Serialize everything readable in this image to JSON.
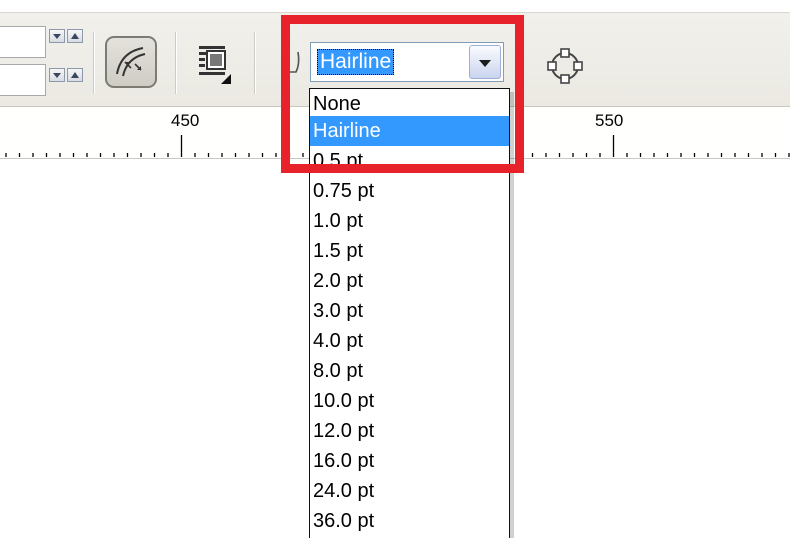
{
  "toolbar": {
    "outline_width": {
      "value": "Hairline",
      "options": [
        "None",
        "Hairline",
        "0.5 pt",
        "0.75 pt",
        "1.0 pt",
        "1.5 pt",
        "2.0 pt",
        "3.0 pt",
        "4.0 pt",
        "8.0 pt",
        "10.0 pt",
        "12.0 pt",
        "16.0 pt",
        "24.0 pt",
        "36.0 pt"
      ],
      "selected_option": "Hairline"
    },
    "icons": [
      "spin-up-icon",
      "spin-down-icon",
      "curve-direction-icon",
      "text-wrap-icon",
      "pen-nib-icon",
      "ellipse-nodes-icon"
    ]
  },
  "ruler": {
    "labels": [
      "450",
      "550"
    ]
  },
  "highlight": {
    "color": "#e8222b"
  }
}
